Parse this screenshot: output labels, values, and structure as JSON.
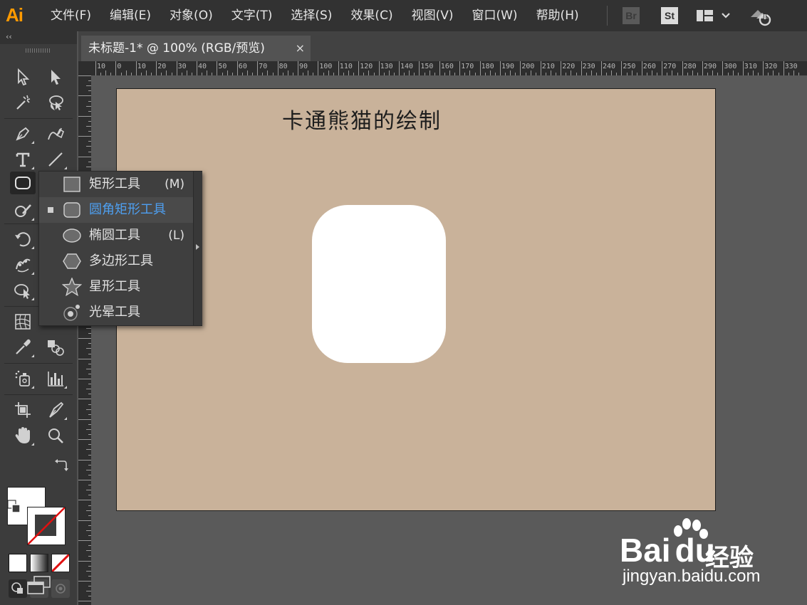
{
  "app": {
    "logo": "Ai",
    "brand_color": "#ff9a00"
  },
  "menu": [
    "文件(F)",
    "编辑(E)",
    "对象(O)",
    "文字(T)",
    "选择(S)",
    "效果(C)",
    "视图(V)",
    "窗口(W)",
    "帮助(H)"
  ],
  "app_icons": {
    "bridge": "Br",
    "stock": "St"
  },
  "toolbar": {
    "collapse": "‹‹"
  },
  "document_tab": {
    "title": "未标题-1* @ 100% (RGB/预览)",
    "close": "×"
  },
  "ruler": {
    "h_labels": [
      "10",
      "0",
      "10",
      "20",
      "30",
      "40",
      "50",
      "60",
      "70",
      "80",
      "90",
      "100",
      "110",
      "120",
      "130",
      "140",
      "150",
      "160",
      "170",
      "180",
      "190",
      "200",
      "210",
      "220",
      "230",
      "240",
      "250",
      "260",
      "270",
      "280",
      "290",
      "300",
      "310",
      "320",
      "330"
    ]
  },
  "artboard": {
    "title": "卡通熊猫的绘制",
    "background": "#c9b29a"
  },
  "flyout": {
    "items": [
      {
        "label": "矩形工具",
        "shortcut": "(M)",
        "icon": "rectangle-icon",
        "selected": false
      },
      {
        "label": "圆角矩形工具",
        "shortcut": "",
        "icon": "rounded-rectangle-icon",
        "selected": true
      },
      {
        "label": "椭圆工具",
        "shortcut": "(L)",
        "icon": "ellipse-icon",
        "selected": false
      },
      {
        "label": "多边形工具",
        "shortcut": "",
        "icon": "polygon-icon",
        "selected": false
      },
      {
        "label": "星形工具",
        "shortcut": "",
        "icon": "star-icon",
        "selected": false
      },
      {
        "label": "光晕工具",
        "shortcut": "",
        "icon": "flare-icon",
        "selected": false
      }
    ],
    "highlight_color": "#4e9ff0"
  },
  "watermark": {
    "brand": "Bai",
    "brand2": "du",
    "cn": "经验",
    "url": "jingyan.baidu.com"
  }
}
